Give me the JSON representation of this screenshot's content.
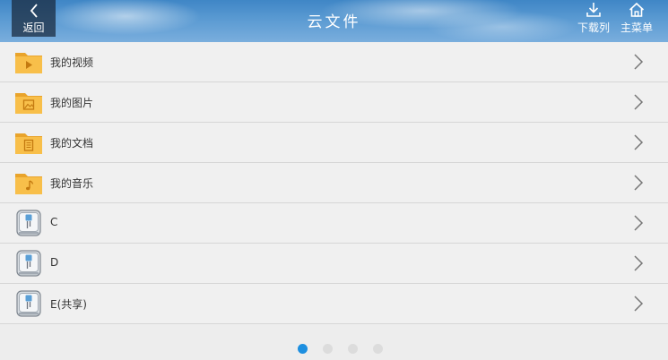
{
  "header": {
    "back_label": "返回",
    "title": "云文件",
    "download_label": "下载列",
    "menu_label": "主菜单"
  },
  "list": {
    "items": [
      {
        "label": "我的视频",
        "icon": "folder-video-icon"
      },
      {
        "label": "我的图片",
        "icon": "folder-image-icon"
      },
      {
        "label": "我的文档",
        "icon": "folder-document-icon"
      },
      {
        "label": "我的音乐",
        "icon": "folder-music-icon"
      },
      {
        "label": "C",
        "icon": "drive-icon"
      },
      {
        "label": "D",
        "icon": "drive-icon"
      },
      {
        "label": "E(共享)",
        "icon": "drive-icon"
      }
    ]
  },
  "pagination": {
    "pages": 4,
    "active_index": 0,
    "active_color": "#1d8fe0",
    "inactive_color": "#dcdcdc"
  },
  "colors": {
    "folder": "#f6b73c",
    "row_bg": "#f0f0f0",
    "divider": "#d6d6d6"
  }
}
